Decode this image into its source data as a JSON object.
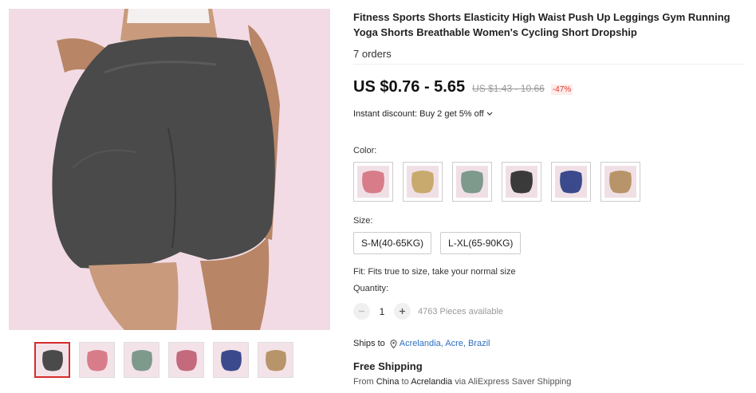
{
  "product": {
    "title": "Fitness Sports Shorts Elasticity High Waist Push Up Leggings Gym Running Yoga Shorts Breathable Women's Cycling Short Dropship",
    "orders": "7 orders",
    "price": "US $0.76 - 5.65",
    "original_price": "US $1.43 - 10.66",
    "discount": "-47%",
    "instant_discount": "Instant discount: Buy 2 get 5% off",
    "color_label": "Color:",
    "size_label": "Size:",
    "sizes": [
      "S-M(40-65KG)",
      "L-XL(65-90KG)"
    ],
    "fit": "Fit: Fits true to size, take your normal size",
    "quantity_label": "Quantity:",
    "quantity": "1",
    "available": "4763 Pieces available",
    "ships_to_label": "Ships to",
    "ships_to_location": "Acrelandia, Acre, Brazil",
    "shipping_title": "Free Shipping",
    "shipping_from_prefix": "From",
    "shipping_from_country": "China",
    "shipping_to_word": "to",
    "shipping_to_city": "Acrelandia",
    "shipping_via": "via AliExpress Saver Shipping"
  },
  "gallery": {
    "main_color": "#4a4a4a",
    "thumbnail_colors": [
      "#4a4a4a",
      "#d87c8a",
      "#7d9a8c",
      "#c46a7c",
      "#3a4a8c",
      "#b8946a"
    ],
    "active_thumbnail": 0
  },
  "swatches": {
    "colors": [
      "#d87c8a",
      "#c9aa6e",
      "#7d9a8c",
      "#3a3a3a",
      "#3a4a8c",
      "#b8946a"
    ]
  },
  "icons": {
    "quantity_decrease": "minus-icon",
    "quantity_increase": "plus-icon",
    "location": "location-pin-icon",
    "dropdown": "chevron-down-icon"
  },
  "colors": {
    "accent_red": "#e0352b",
    "link_blue": "#2e6fbf"
  }
}
